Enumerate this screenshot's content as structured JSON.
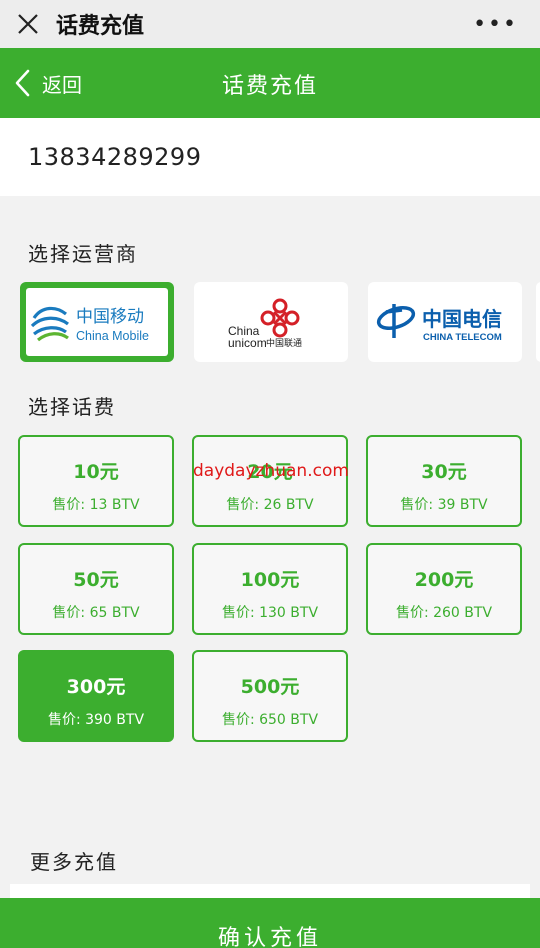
{
  "window": {
    "title": "话费充值",
    "more": "•••"
  },
  "nav": {
    "back_label": "返回",
    "title": "话费充值"
  },
  "phone": {
    "value": "13834289299"
  },
  "carrier_section": {
    "label": "选择运营商"
  },
  "carriers": [
    {
      "name_cn": "中国移动",
      "name_en": "China Mobile",
      "selected": true
    },
    {
      "name_en_1": "China",
      "name_en_2": "unicom",
      "name_cn": "中国联通",
      "selected": false
    },
    {
      "name_cn": "中国电信",
      "name_en": "CHINA TELECOM",
      "selected": false
    }
  ],
  "fee_section": {
    "label": "选择话费"
  },
  "fees": [
    {
      "amount": "10元",
      "price": "售价: 13 BTV",
      "selected": false
    },
    {
      "amount": "20元",
      "price": "售价: 26 BTV",
      "selected": false
    },
    {
      "amount": "30元",
      "price": "售价: 39 BTV",
      "selected": false
    },
    {
      "amount": "50元",
      "price": "售价: 65 BTV",
      "selected": false
    },
    {
      "amount": "100元",
      "price": "售价: 130 BTV",
      "selected": false
    },
    {
      "amount": "200元",
      "price": "售价: 260 BTV",
      "selected": false
    },
    {
      "amount": "300元",
      "price": "售价: 390 BTV",
      "selected": true
    },
    {
      "amount": "500元",
      "price": "售价: 650 BTV",
      "selected": false
    }
  ],
  "watermark": "daydayzhuan.com",
  "more_section": {
    "label": "更多充值"
  },
  "confirm": {
    "label": "确认充值"
  },
  "colors": {
    "brand_green": "#3cae2f",
    "mobile_blue": "#1a7bbf",
    "unicom_red": "#d42027",
    "telecom_blue": "#0b5fad",
    "watermark_red": "#e01919"
  },
  "icons": [
    "close-icon",
    "more-icon",
    "back-arrow-icon",
    "china-mobile-logo",
    "china-unicom-logo",
    "china-telecom-logo"
  ]
}
